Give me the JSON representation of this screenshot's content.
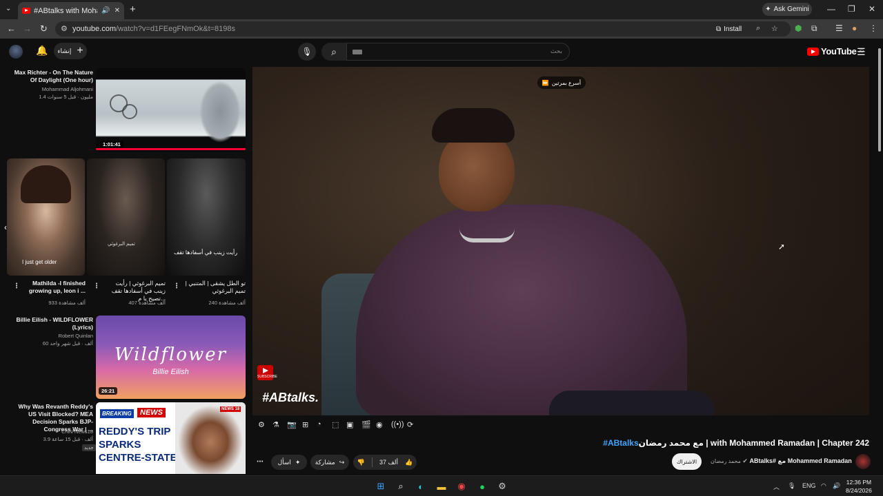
{
  "browser": {
    "tab_title": "#ABtalks with Mohammed",
    "new_tab": "+",
    "ask_gemini": "Ask Gemini",
    "url_main": "youtube.com",
    "url_rest": "/watch?v=d1FEegFNmOk&t=8198s",
    "install_label": "Install",
    "win_min": "—",
    "win_max": "❐",
    "win_close": "✕"
  },
  "yt": {
    "create_label": "إنشاء",
    "search_placeholder": "بحث",
    "logo_text": "YouTube",
    "logo_region": "JO"
  },
  "recs": [
    {
      "title": "Max Richter - On The Nature Of Daylight (One hour)",
      "channel": "Mohammad Aljohmani",
      "meta": "1.4 مليون · قبل 5 سنوات",
      "duration": "1:01:41"
    },
    {
      "title": "Mathilda -I finished growing up, leon i ...",
      "meta": "933 ألف مشاهدة"
    },
    {
      "title": "تميم البرغوثي | رأيت زينب في أسفادها تقف تصيح يا م...",
      "meta": "407 ألف مشاهدة"
    },
    {
      "title": "تو الطل يشقى | المتنبي | تميم البرغوثي",
      "meta": "240 ألف مشاهدة"
    },
    {
      "title": "Billie Eilish - WILDFLOWER (Lyrics)",
      "channel": "Robert Quinlan",
      "meta": "60 ألف · قبل شهر واحد",
      "duration": "26:21",
      "thumb_text": "Wildflower",
      "thumb_sub": "Billie Eilish"
    },
    {
      "title": "Why Was Revanth Reddy's US Visit Blocked? MEA Decision Sparks BJP-Congress War | ...",
      "channel": "CNN-News18",
      "meta": "3.9 ألف · قبل 15 ساعة",
      "badge": "جديد",
      "breaking": "BREAKING",
      "news": "NEWS",
      "headline_1": "REDDY'S TRIP",
      "headline_2": "SPARKS",
      "headline_3": "CENTRE-STATE",
      "headline_4": "WAR",
      "news_logo": "NEWS 18"
    }
  ],
  "shorts_captions": {
    "s1": "I just get older",
    "s2": "تميم البرغوثي",
    "s3": "رأيت زينب في أسفادها تقف"
  },
  "player": {
    "speed_label": "أسرع بمرتين",
    "watermark": "#ABtalks.",
    "subscribe_badge": "SUBSCRIBE"
  },
  "video": {
    "title_tag": "#ABtalks",
    "title_rest": "مع محمد رمضان | with Mohammed Ramadan | Chapter 242",
    "like_count": "37 ألف",
    "share_label": "مشاركة",
    "ask_label": "اسأل",
    "subscribe_label": "الاشتراك",
    "channel_name": "ABtalks# مع Mohammed Ramadan",
    "channel_sub": "محمد رمضان"
  },
  "taskbar": {
    "lang": "ENG",
    "time": "12:36 PM",
    "date": "8/24/2026"
  },
  "colors": {
    "accent_blue": "#3ea6ff",
    "yt_red": "#ff0000",
    "bg": "#0f0f0f"
  }
}
